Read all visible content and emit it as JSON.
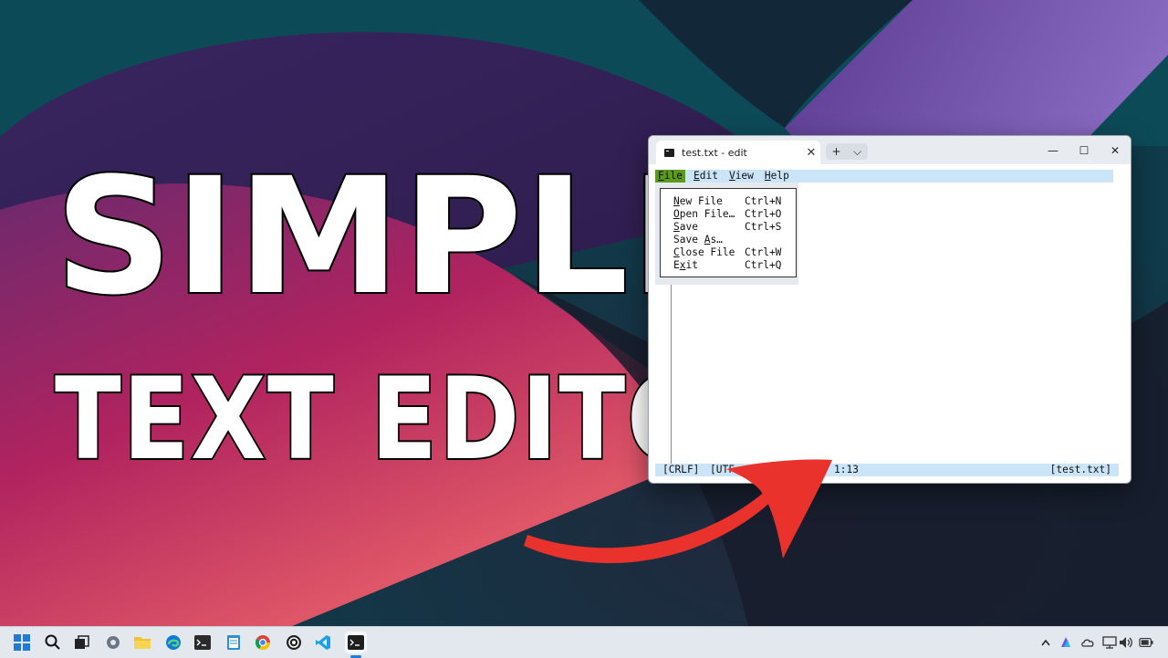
{
  "headline": {
    "line1": "SIMPLE",
    "line2": "TEXT EDITOR"
  },
  "window": {
    "tab_title": "test.txt - edit",
    "tab_close": "✕",
    "new_tab": "+",
    "tab_dropdown": "⌵",
    "minimize": "—",
    "maximize": "☐",
    "close": "✕"
  },
  "menubar": {
    "items": [
      {
        "label": "File",
        "accel": "F",
        "rest": "ile",
        "active": true
      },
      {
        "label": "Edit",
        "accel": "E",
        "rest": "dit",
        "active": false
      },
      {
        "label": "View",
        "accel": "V",
        "rest": "iew",
        "active": false
      },
      {
        "label": "Help",
        "accel": "H",
        "rest": "elp",
        "active": false
      }
    ]
  },
  "file_menu": {
    "items": [
      {
        "pre": "",
        "accel": "N",
        "post": "ew File",
        "shortcut": "Ctrl+N"
      },
      {
        "pre": "",
        "accel": "O",
        "post": "pen File…",
        "shortcut": "Ctrl+O"
      },
      {
        "pre": "",
        "accel": "S",
        "post": "ave",
        "shortcut": "Ctrl+S"
      },
      {
        "pre": "Save ",
        "accel": "A",
        "post": "s…",
        "shortcut": ""
      },
      {
        "pre": "",
        "accel": "C",
        "post": "lose File",
        "shortcut": "Ctrl+W"
      },
      {
        "pre": "E",
        "accel": "x",
        "post": "it",
        "shortcut": "Ctrl+Q"
      }
    ]
  },
  "statusbar": {
    "line_ending": "[CRLF]",
    "encoding": "[UTF",
    "position": "1:13",
    "filename": "[test.txt]"
  },
  "colors": {
    "menu_active": "#5c9a1e",
    "menubar_bg": "#cce4f7",
    "arrow": "#e8322b"
  },
  "taskbar": {
    "icons": [
      "windows-start-icon",
      "search-icon",
      "task-view-icon",
      "settings-icon",
      "file-explorer-icon",
      "edge-icon",
      "terminal-app-icon",
      "notepad-icon",
      "chrome-icon",
      "app-circle-icon",
      "vscode-icon",
      "terminal-active-icon"
    ],
    "tray": [
      "chevron-up-icon",
      "copilot-icon",
      "onedrive-cloud-icon",
      "network-icon",
      "volume-icon",
      "battery-icon"
    ]
  }
}
